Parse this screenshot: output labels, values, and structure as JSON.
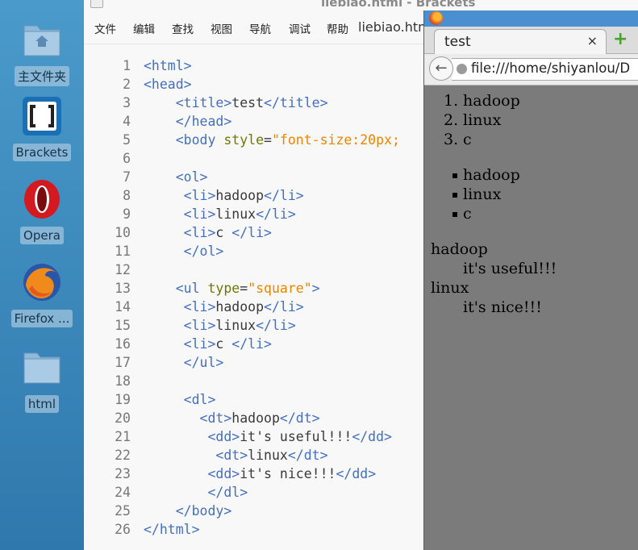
{
  "desktop": {
    "icons": [
      {
        "label": "主文件夹",
        "icon": "home-folder-icon"
      },
      {
        "label": "Brackets",
        "icon": "brackets-app-icon"
      },
      {
        "label": "Opera",
        "icon": "opera-icon"
      },
      {
        "label": "Firefox ...",
        "icon": "firefox-icon"
      },
      {
        "label": "html",
        "icon": "folder-icon"
      }
    ]
  },
  "editor": {
    "window_title": "liebiao.html - Brackets",
    "menu": [
      "文件",
      "编辑",
      "查找",
      "视图",
      "导航",
      "调试",
      "帮助"
    ],
    "file_name": "liebiao.htm",
    "colors": {
      "tag": "#446fbd",
      "attr": "#6c7a00",
      "string": "#e88501",
      "text": "#3a3a3a"
    },
    "lines": [
      {
        "n": "1",
        "code": [
          {
            "t": "tg",
            "v": "<html>"
          }
        ]
      },
      {
        "n": "2",
        "code": [
          {
            "t": "tg",
            "v": "<head>"
          }
        ]
      },
      {
        "n": "3",
        "code": [
          {
            "t": "tx",
            "v": "    "
          },
          {
            "t": "tg",
            "v": "<title>"
          },
          {
            "t": "tx",
            "v": "test"
          },
          {
            "t": "tg",
            "v": "</title>"
          }
        ]
      },
      {
        "n": "4",
        "code": [
          {
            "t": "tx",
            "v": "    "
          },
          {
            "t": "tg",
            "v": "</head>"
          }
        ]
      },
      {
        "n": "5",
        "code": [
          {
            "t": "tx",
            "v": "    "
          },
          {
            "t": "tg",
            "v": "<body "
          },
          {
            "t": "at",
            "v": "style"
          },
          {
            "t": "tx",
            "v": "="
          },
          {
            "t": "st",
            "v": "\"font-size:20px;"
          }
        ]
      },
      {
        "n": "6",
        "code": []
      },
      {
        "n": "7",
        "code": [
          {
            "t": "tx",
            "v": "    "
          },
          {
            "t": "tg",
            "v": "<ol>"
          }
        ]
      },
      {
        "n": "8",
        "code": [
          {
            "t": "tx",
            "v": "     "
          },
          {
            "t": "tg",
            "v": "<li>"
          },
          {
            "t": "tx",
            "v": "hadoop"
          },
          {
            "t": "tg",
            "v": "</li>"
          }
        ]
      },
      {
        "n": "9",
        "code": [
          {
            "t": "tx",
            "v": "     "
          },
          {
            "t": "tg",
            "v": "<li>"
          },
          {
            "t": "tx",
            "v": "linux"
          },
          {
            "t": "tg",
            "v": "</li>"
          }
        ]
      },
      {
        "n": "10",
        "code": [
          {
            "t": "tx",
            "v": "     "
          },
          {
            "t": "tg",
            "v": "<li>"
          },
          {
            "t": "tx",
            "v": "c "
          },
          {
            "t": "tg",
            "v": "</li>"
          }
        ]
      },
      {
        "n": "11",
        "code": [
          {
            "t": "tx",
            "v": "     "
          },
          {
            "t": "tg",
            "v": "</ol>"
          }
        ]
      },
      {
        "n": "12",
        "code": []
      },
      {
        "n": "13",
        "code": [
          {
            "t": "tx",
            "v": "    "
          },
          {
            "t": "tg",
            "v": "<ul "
          },
          {
            "t": "at",
            "v": "type"
          },
          {
            "t": "tx",
            "v": "="
          },
          {
            "t": "st",
            "v": "\"square\""
          },
          {
            "t": "tg",
            "v": ">"
          }
        ]
      },
      {
        "n": "14",
        "code": [
          {
            "t": "tx",
            "v": "     "
          },
          {
            "t": "tg",
            "v": "<li>"
          },
          {
            "t": "tx",
            "v": "hadoop"
          },
          {
            "t": "tg",
            "v": "</li>"
          }
        ]
      },
      {
        "n": "15",
        "code": [
          {
            "t": "tx",
            "v": "     "
          },
          {
            "t": "tg",
            "v": "<li>"
          },
          {
            "t": "tx",
            "v": "linux"
          },
          {
            "t": "tg",
            "v": "</li>"
          }
        ]
      },
      {
        "n": "16",
        "code": [
          {
            "t": "tx",
            "v": "     "
          },
          {
            "t": "tg",
            "v": "<li>"
          },
          {
            "t": "tx",
            "v": "c "
          },
          {
            "t": "tg",
            "v": "</li>"
          }
        ]
      },
      {
        "n": "17",
        "code": [
          {
            "t": "tx",
            "v": "     "
          },
          {
            "t": "tg",
            "v": "</ul>"
          }
        ]
      },
      {
        "n": "18",
        "code": []
      },
      {
        "n": "19",
        "code": [
          {
            "t": "tx",
            "v": "     "
          },
          {
            "t": "tg",
            "v": "<dl>"
          }
        ]
      },
      {
        "n": "20",
        "code": [
          {
            "t": "tx",
            "v": "       "
          },
          {
            "t": "tg",
            "v": "<dt>"
          },
          {
            "t": "tx",
            "v": "hadoop"
          },
          {
            "t": "tg",
            "v": "</dt>"
          }
        ]
      },
      {
        "n": "21",
        "code": [
          {
            "t": "tx",
            "v": "        "
          },
          {
            "t": "tg",
            "v": "<dd>"
          },
          {
            "t": "tx",
            "v": "it's useful!!!"
          },
          {
            "t": "tg",
            "v": "</dd>"
          }
        ]
      },
      {
        "n": "22",
        "code": [
          {
            "t": "tx",
            "v": "         "
          },
          {
            "t": "tg",
            "v": "<dt>"
          },
          {
            "t": "tx",
            "v": "linux"
          },
          {
            "t": "tg",
            "v": "</dt>"
          }
        ]
      },
      {
        "n": "23",
        "code": [
          {
            "t": "tx",
            "v": "        "
          },
          {
            "t": "tg",
            "v": "<dd>"
          },
          {
            "t": "tx",
            "v": "it's nice!!!"
          },
          {
            "t": "tg",
            "v": "</dd>"
          }
        ]
      },
      {
        "n": "24",
        "code": [
          {
            "t": "tx",
            "v": "        "
          },
          {
            "t": "tg",
            "v": "</dl>"
          }
        ]
      },
      {
        "n": "25",
        "code": [
          {
            "t": "tx",
            "v": "    "
          },
          {
            "t": "tg",
            "v": "</body>"
          }
        ]
      },
      {
        "n": "26",
        "code": [
          {
            "t": "tg",
            "v": "</html>"
          }
        ]
      }
    ]
  },
  "browser": {
    "tab_title": "test",
    "tab_close": "×",
    "new_tab": "+",
    "url": "file:///home/shiyanlou/D",
    "ordered_list": [
      {
        "marker": "1.",
        "text": "hadoop"
      },
      {
        "marker": "2.",
        "text": "linux"
      },
      {
        "marker": "3.",
        "text": "c"
      }
    ],
    "square_list": [
      "hadoop",
      "linux",
      "c"
    ],
    "definition_list": [
      {
        "term": "hadoop",
        "desc": "it's useful!!!"
      },
      {
        "term": "linux",
        "desc": "it's nice!!!"
      }
    ]
  }
}
